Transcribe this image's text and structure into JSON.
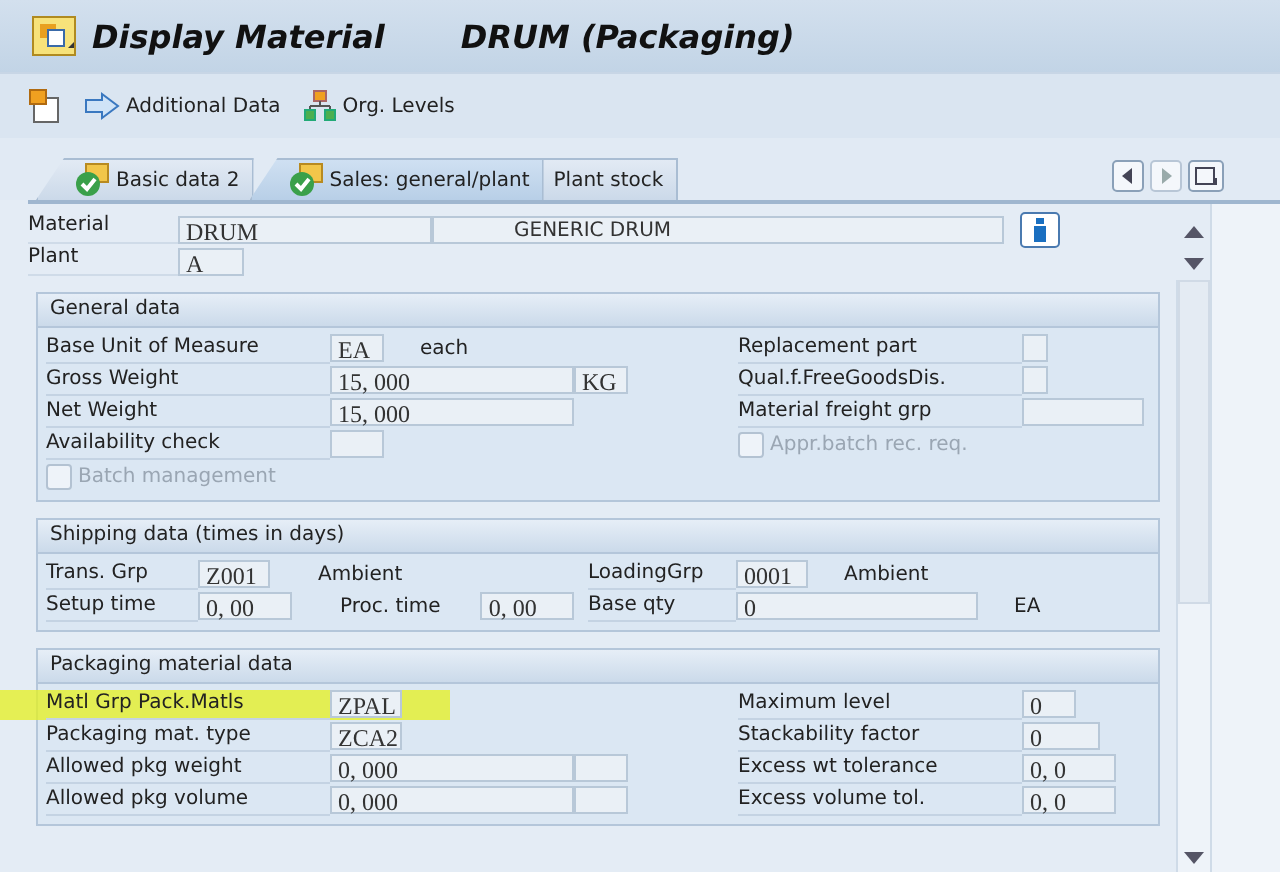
{
  "window": {
    "title_parts": [
      "Display Material",
      "DRUM (Packaging)"
    ]
  },
  "toolbar": [
    {
      "kind": "create"
    },
    {
      "kind": "arrow",
      "label": "Additional Data"
    },
    {
      "kind": "hierarchy",
      "label": "Org. Levels"
    }
  ],
  "tabs": [
    {
      "label": "Basic data 2",
      "selected": false,
      "done": true
    },
    {
      "label": "Sales: general/plant",
      "selected": true,
      "done": true
    },
    {
      "label": "Plant stock",
      "selected": false,
      "done": false
    }
  ],
  "header": {
    "material_label": "Material",
    "material": "DRUM",
    "description": "GENERIC DRUM",
    "plant_label": "Plant",
    "plant": "A"
  },
  "sections": [
    {
      "title": "General data",
      "kind": "form",
      "left": [
        [
          {
            "kind": "label",
            "text": "Base Unit of Measure"
          },
          {
            "kind": "short",
            "value": "EA"
          },
          {
            "kind": "text",
            "text": "each"
          }
        ],
        [
          {
            "kind": "label",
            "text": "Gross Weight"
          },
          {
            "kind": "long",
            "value": "15, 000"
          },
          {
            "kind": "unit",
            "value": "KG"
          }
        ],
        [
          {
            "kind": "label",
            "text": "Net Weight"
          },
          {
            "kind": "long",
            "value": "15, 000"
          }
        ],
        [
          {
            "kind": "label",
            "text": "Availability check"
          },
          {
            "kind": "unit"
          }
        ],
        [
          {
            "kind": "checkbox",
            "text": "Batch management",
            "checked": false,
            "disabled": true
          }
        ]
      ],
      "right": [
        [
          {
            "kind": "label",
            "text": "Replacement part"
          },
          {
            "kind": "tiny"
          }
        ],
        [
          {
            "kind": "label",
            "text": "Qual.f.FreeGoodsDis."
          },
          {
            "kind": "tiny"
          }
        ],
        [
          {
            "kind": "label",
            "text": "Material freight grp"
          },
          {
            "kind": "mid"
          }
        ],
        [
          {
            "kind": "checkbox",
            "text": "Appr.batch rec. req.",
            "checked": false,
            "disabled": true
          }
        ]
      ]
    },
    {
      "title": "Shipping data (times in days)",
      "kind": "inline",
      "left": [
        [
          {
            "kind": "label",
            "text": "Trans. Grp"
          },
          {
            "kind": "code",
            "value": "Z001"
          },
          {
            "kind": "text",
            "text": "Ambient"
          }
        ],
        [
          {
            "kind": "label",
            "text": "Setup time"
          },
          {
            "kind": "time",
            "value": "0, 00"
          },
          {
            "kind": "text",
            "text": "Proc. time"
          },
          {
            "kind": "time",
            "value": "0, 00"
          }
        ]
      ],
      "right": [
        [
          {
            "kind": "label",
            "text": "LoadingGrp"
          },
          {
            "kind": "code",
            "value": "0001"
          },
          {
            "kind": "text",
            "text": "Ambient"
          }
        ],
        [
          {
            "kind": "label",
            "text": "Base qty"
          },
          {
            "kind": "long",
            "value": "0"
          },
          {
            "kind": "text",
            "text": "EA"
          }
        ]
      ]
    },
    {
      "title": "Packaging material data",
      "kind": "form",
      "left": [
        [
          {
            "kind": "label",
            "text": "Matl Grp Pack.Matls",
            "highlighted": true
          },
          {
            "kind": "code",
            "value": "ZPAL"
          }
        ],
        [
          {
            "kind": "label",
            "text": "Packaging mat. type"
          },
          {
            "kind": "code",
            "value": "ZCA2"
          }
        ],
        [
          {
            "kind": "label",
            "text": "Allowed pkg weight"
          },
          {
            "kind": "long",
            "value": "0, 000"
          },
          {
            "kind": "unit"
          }
        ],
        [
          {
            "kind": "label",
            "text": "Allowed pkg volume"
          },
          {
            "kind": "long",
            "value": "0, 000"
          },
          {
            "kind": "unit"
          }
        ]
      ],
      "right": [
        [
          {
            "kind": "label",
            "text": "Maximum level"
          },
          {
            "kind": "unit",
            "value": "0"
          }
        ],
        [
          {
            "kind": "label",
            "text": "Stackability factor"
          },
          {
            "kind": "qty",
            "value": "0"
          }
        ],
        [
          {
            "kind": "label",
            "text": "Excess wt tolerance"
          },
          {
            "kind": "time",
            "value": "0, 0"
          }
        ],
        [
          {
            "kind": "label",
            "text": "Excess volume tol."
          },
          {
            "kind": "time",
            "value": "0, 0"
          }
        ]
      ]
    }
  ]
}
